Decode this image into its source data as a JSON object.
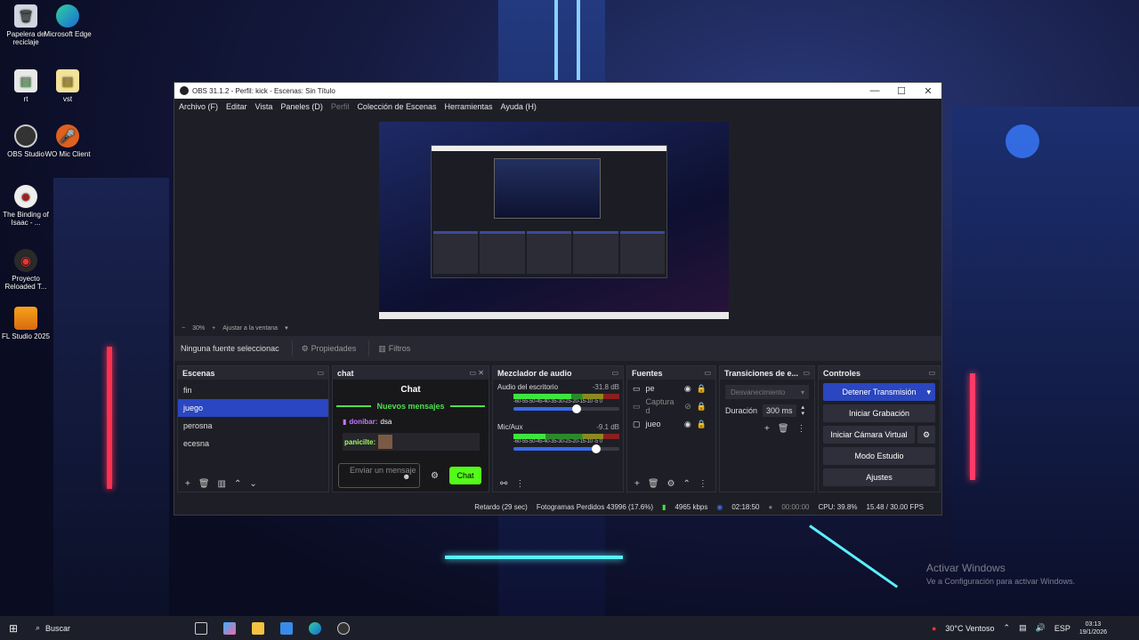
{
  "desktop": {
    "icons": [
      {
        "label": "Papelera de reciclaje",
        "icon": "recycle-bin-icon"
      },
      {
        "label": "Microsoft Edge",
        "icon": "edge-icon"
      },
      {
        "label": "rt",
        "icon": "file-icon"
      },
      {
        "label": "vst",
        "icon": "file-icon"
      },
      {
        "label": "OBS Studio",
        "icon": "obs-icon"
      },
      {
        "label": "WO Mic Client",
        "icon": "microphone-icon"
      },
      {
        "label": "The Binding of Isaac - ...",
        "icon": "game-icon"
      },
      {
        "label": "Proyecto Reloaded T...",
        "icon": "game-icon"
      },
      {
        "label": "FL Studio 2025",
        "icon": "fl-studio-icon"
      }
    ],
    "activate_title": "Activar Windows",
    "activate_sub": "Ve a Configuración para activar Windows."
  },
  "window": {
    "title": "OBS 31.1.2 - Perfil: kick - Escenas: Sin Título",
    "minimize": "—",
    "maximize": "☐",
    "close": "✕"
  },
  "menu": [
    "Archivo (F)",
    "Editar",
    "Vista",
    "Paneles (D)",
    "Perfil",
    "Colección de Escenas",
    "Herramientas",
    "Ayuda (H)"
  ],
  "zoom": {
    "minus": "−",
    "value": "30%",
    "plus": "+",
    "fit": "Ajustar a la ventana",
    "caret": "▾"
  },
  "source_bar": {
    "none_selected": "Ninguna fuente seleccionac",
    "properties": "Propiedades",
    "filters": "Filtros"
  },
  "scenes": {
    "title": "Escenas",
    "items": [
      "fin",
      "juego",
      "perosna",
      "ecesna"
    ],
    "selected_index": 1
  },
  "chat": {
    "dock_title": "chat",
    "title": "Chat",
    "new_messages": "Nuevos mensajes",
    "messages": [
      {
        "user": "donibar:",
        "text": "dsa"
      },
      {
        "user": "panicilte:",
        "text": ""
      }
    ],
    "input_placeholder": "Enviar un mensaje",
    "send": "Chat"
  },
  "mixer": {
    "title": "Mezclador de audio",
    "channels": [
      {
        "name": "Audio del escritorio",
        "db": "-31.8 dB",
        "level": 0.55,
        "volume": 0.6
      },
      {
        "name": "Mic/Aux",
        "db": "-9.1 dB",
        "level": 0.3,
        "volume": 0.78
      }
    ],
    "ticks": "-60-55-50-45-40-35-30-25-20-15-10 -5 0"
  },
  "sources": {
    "title": "Fuentes",
    "items": [
      {
        "name": "pe",
        "hidden": false,
        "icon": "camera-icon"
      },
      {
        "name": "Captura d",
        "hidden": true,
        "icon": "monitor-icon"
      },
      {
        "name": "jueo",
        "hidden": false,
        "icon": "window-icon"
      }
    ]
  },
  "transitions": {
    "title": "Transiciones de e...",
    "selected": "Desvanecimiento",
    "duration_label": "Duración",
    "duration_value": "300 ms"
  },
  "controls": {
    "title": "Controles",
    "buttons": [
      "Detener Transmisión",
      "Iniciar Grabación",
      "Iniciar Cámara Virtual",
      "Modo Estudio",
      "Ajustes"
    ]
  },
  "status": {
    "delay": "Retardo (29 sec)",
    "dropped": "Fotogramas Perdidos 43996 (17.6%)",
    "bitrate": "4965 kbps",
    "live_time": "02:18:50",
    "rec_time": "00:00:00",
    "cpu": "CPU: 39.8%",
    "fps": "15.48 / 30.00 FPS"
  },
  "taskbar": {
    "search": "Buscar",
    "weather": "30°C Ventoso",
    "lang": "ESP",
    "time": "03:13",
    "date": "19/1/2026"
  },
  "colors": {
    "accent": "#2a46c0",
    "kick_green": "#53fc18",
    "meter_green": "#3fe43f"
  }
}
